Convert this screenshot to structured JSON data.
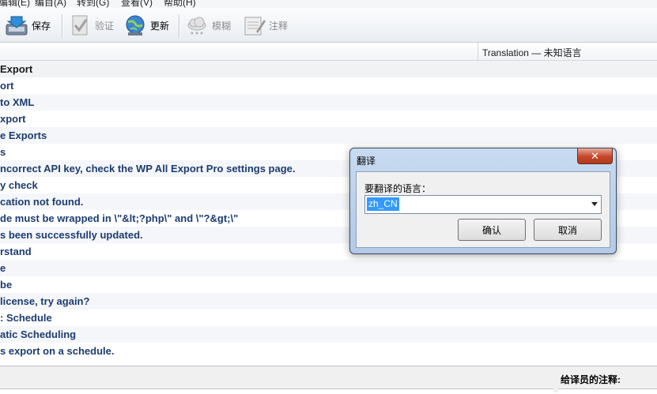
{
  "menu": [
    "编辑(E)",
    "编目(A)",
    "转到(G)",
    "查看(V)",
    "帮助(H)"
  ],
  "toolbar": {
    "save": "保存",
    "validate": "验证",
    "update": "更新",
    "fuzzy": "模糊",
    "comment": "注释"
  },
  "column_header": "Translation — 未知语言",
  "rows": [
    {
      "text": "Export",
      "section": true
    },
    {
      "text": "ort"
    },
    {
      "text": "to XML"
    },
    {
      "text": "xport"
    },
    {
      "text": "e Exports"
    },
    {
      "text": "s"
    },
    {
      "text": "ncorrect API key, check the WP All Export Pro settings page."
    },
    {
      "text": "y check"
    },
    {
      "text": "cation not found."
    },
    {
      "text": "de must be wrapped in \\\"&lt;?php\\\" and \\\"?&gt;\\\""
    },
    {
      "text": "s been successfully updated."
    },
    {
      "text": "rstand"
    },
    {
      "text": "e"
    },
    {
      "text": "be"
    },
    {
      "text": " license, try again?"
    },
    {
      "text": ": Schedule"
    },
    {
      "text": "atic Scheduling"
    },
    {
      "text": "s export on a schedule."
    }
  ],
  "translator_note_label": "给译员的注释:",
  "dialog": {
    "title": "翻译",
    "prompt": "要翻译的语言：",
    "language_value": "zh_CN",
    "ok": "确认",
    "cancel": "取消"
  }
}
